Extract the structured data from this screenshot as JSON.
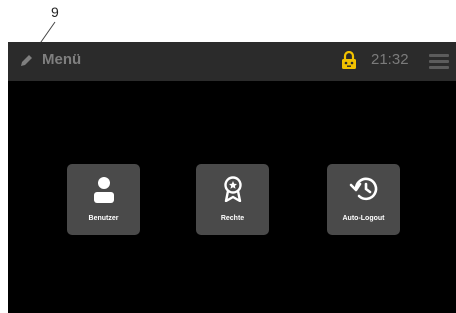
{
  "callout": {
    "number": "9"
  },
  "header": {
    "title": "Menü",
    "time": "21:32",
    "icons": {
      "back": "pencil-back-icon",
      "lock": "lock-icon",
      "menu": "hamburger-menu-icon"
    },
    "colors": {
      "lock": "#f2c200",
      "bar": "#2b2b2b",
      "text": "#7f7f7f"
    }
  },
  "tiles": [
    {
      "label": "Benutzer",
      "icon": "user-icon"
    },
    {
      "label": "Rechte",
      "icon": "ribbon-badge-icon"
    },
    {
      "label": "Auto-Logout",
      "icon": "history-icon"
    }
  ],
  "colors": {
    "tile": "#4a4a4a",
    "screen": "#000000"
  }
}
